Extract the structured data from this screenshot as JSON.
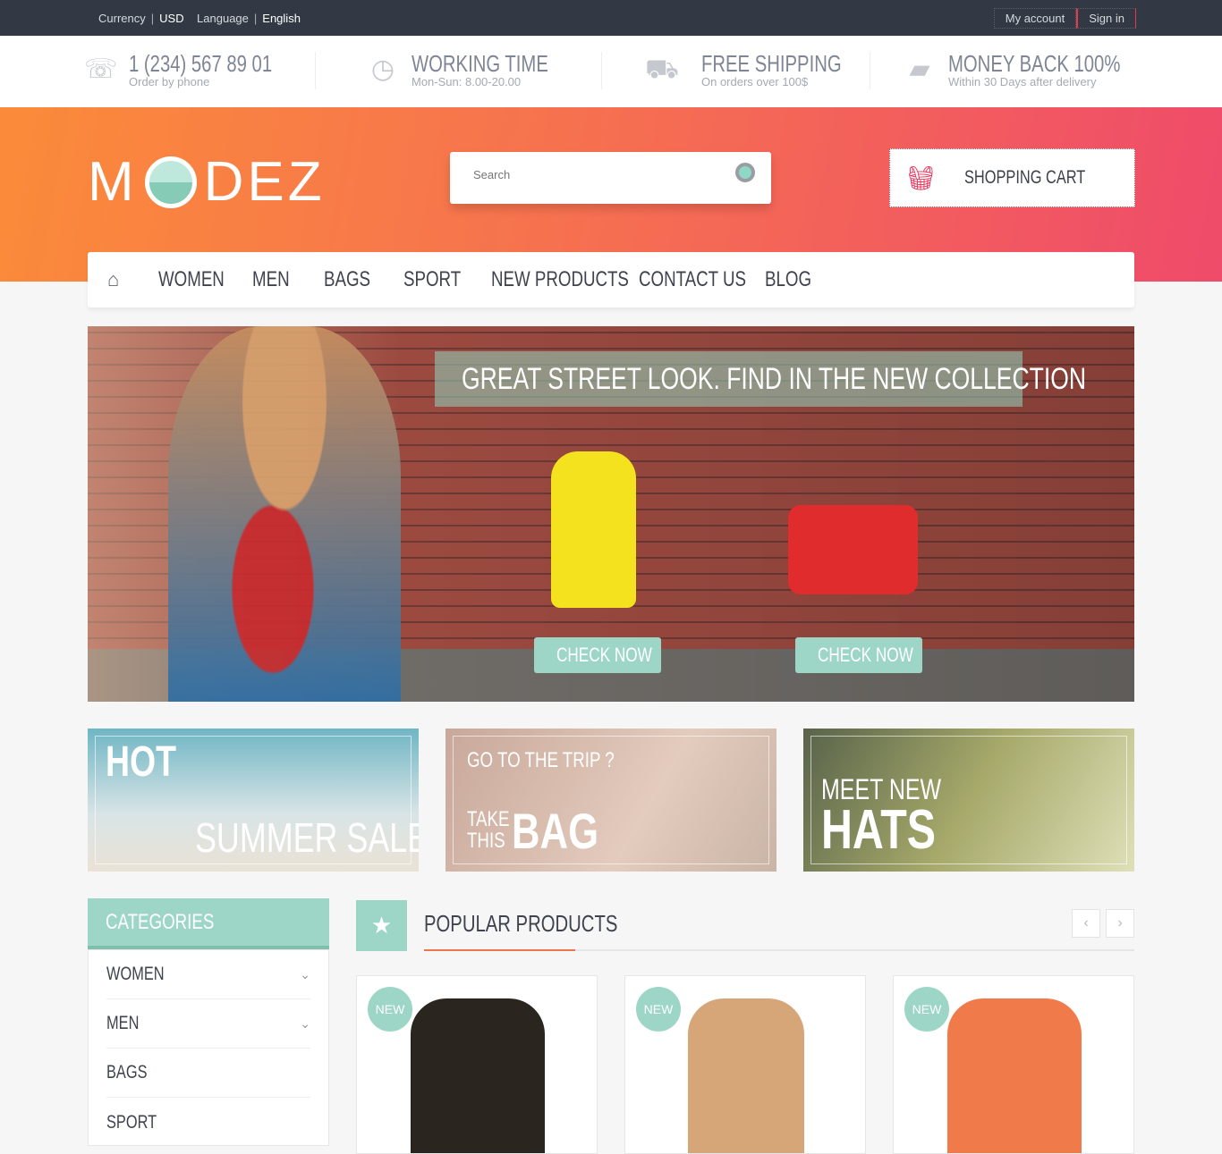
{
  "topbar": {
    "currency_label": "Currency",
    "currency_value": "USD",
    "language_label": "Language",
    "language_value": "English",
    "my_account": "My account",
    "sign_in": "Sign in"
  },
  "info": [
    {
      "title": "1 (234) 567 89 01",
      "sub": "Order by phone",
      "icon": "phone-icon"
    },
    {
      "title": "WORKING TIME",
      "sub": "Mon-Sun: 8.00-20.00",
      "icon": "clock-icon"
    },
    {
      "title": "FREE SHIPPING",
      "sub": "On orders over 100$",
      "icon": "truck-icon"
    },
    {
      "title": "MONEY BACK 100%",
      "sub": "Within 30 Days after delivery",
      "icon": "wallet-icon"
    }
  ],
  "logo": {
    "text_left": "M",
    "text_right": "DEZ"
  },
  "search": {
    "placeholder": "Search"
  },
  "cart": {
    "label": "SHOPPING CART"
  },
  "nav": [
    "WOMEN",
    "MEN",
    "BAGS",
    "SPORT",
    "NEW PRODUCTS",
    "CONTACT US",
    "BLOG"
  ],
  "banner": {
    "title": "GREAT STREET LOOK. FIND IN THE NEW COLLECTION",
    "button1": "CHECK NOW",
    "button2": "CHECK NOW"
  },
  "promos": [
    {
      "line1": "HOT",
      "line2": "SUMMER SALE"
    },
    {
      "line1": "GO TO THE TRIP ?",
      "line2a": "TAKE",
      "line2b": "THIS",
      "line3": "BAG"
    },
    {
      "line1": "MEET NEW",
      "line2": "HATS"
    }
  ],
  "categories": {
    "title": "CATEGORIES",
    "items": [
      "WOMEN",
      "MEN",
      "BAGS",
      "SPORT"
    ]
  },
  "popular": {
    "title": "POPULAR PRODUCTS",
    "badge": "NEW"
  },
  "colors": {
    "accent": "#9dd6c7",
    "brand_gradient_start": "#fb8b3a",
    "brand_gradient_end": "#ef4b6a",
    "highlight": "#f0734f"
  }
}
